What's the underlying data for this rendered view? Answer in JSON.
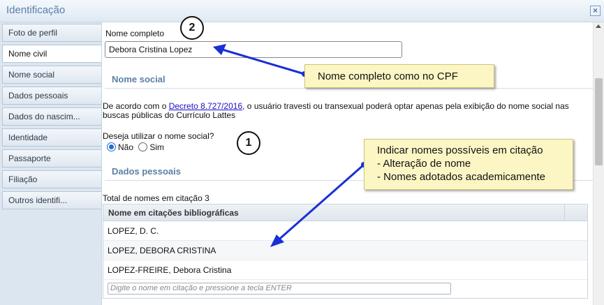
{
  "window": {
    "title": "Identificação",
    "close_icon": "×"
  },
  "sidebar": {
    "items": [
      {
        "label": "Foto de perfil"
      },
      {
        "label": "Nome civil"
      },
      {
        "label": "Nome social"
      },
      {
        "label": "Dados pessoais"
      },
      {
        "label": "Dados do nascim..."
      },
      {
        "label": "Identidade"
      },
      {
        "label": "Passaporte"
      },
      {
        "label": "Filiação"
      },
      {
        "label": "Outros identifi..."
      }
    ],
    "active": "Nome civil"
  },
  "form": {
    "full_name_label": "Nome completo",
    "full_name_value": "Debora Cristina Lopez",
    "social_name_section": "Nome social",
    "notice_prefix": "De acordo com o ",
    "notice_link": "Decreto 8.727/2016",
    "notice_suffix": ", o usuário travesti ou transexual poderá optar apenas pela exibição do nome social nas buscas públicas do Currículo Lattes",
    "question": "Deseja utilizar o nome social?",
    "option_no": "Não",
    "option_yes": "Sim",
    "selected_option": "Não",
    "personal_section": "Dados pessoais"
  },
  "citations": {
    "total_label": "Total de nomes em citação 3",
    "column_header": "Nome em citações bibliográficas",
    "rows": [
      "LOPEZ, D. C.",
      "LOPEZ, DEBORA CRISTINA",
      "LOPEZ-FREIRE, Debora Cristina"
    ],
    "input_placeholder": "Digite o nome em citação e pressione a tecla ENTER"
  },
  "annotations": {
    "callout_1": "Nome completo como no CPF",
    "callout_2_lines": [
      "Indicar nomes possíveis em citação",
      "- Alteração de nome",
      "- Nomes adotados academicamente"
    ],
    "badge_1": "1",
    "badge_2": "2",
    "arrow_color": "#1a2fd6",
    "callout_color": "#fbf6c4"
  }
}
